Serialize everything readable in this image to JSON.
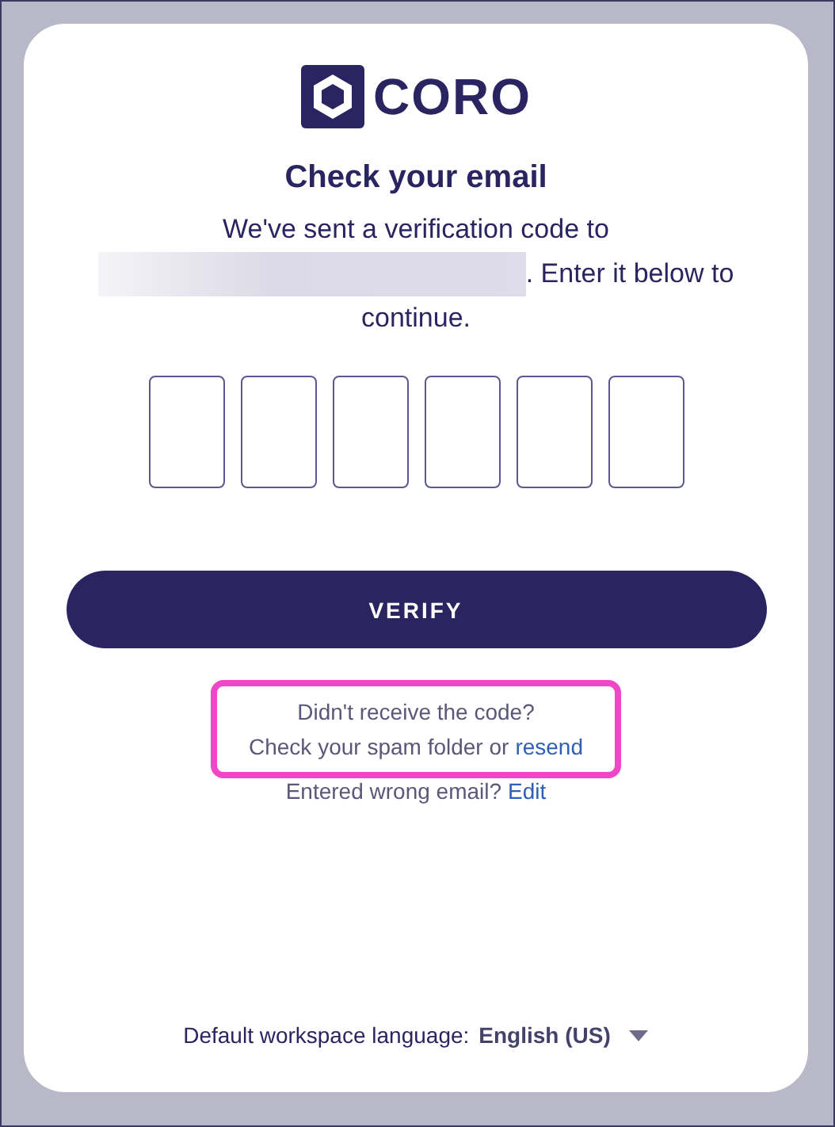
{
  "logo": {
    "wordmark": "CORO"
  },
  "title": "Check your email",
  "message": {
    "before": "We've sent a verification code to",
    "after": ". Enter it below to",
    "continuation": "continue.",
    "email_redacted": true
  },
  "code_inputs": [
    {
      "filled": false
    },
    {
      "filled": false
    },
    {
      "filled": false
    },
    {
      "filled": false
    },
    {
      "filled": false
    },
    {
      "filled": false
    }
  ],
  "verify_button": "VERIFY",
  "help": {
    "highlighted": true,
    "question": "Didn't receive the code?",
    "hint": "Check your spam folder or",
    "link": "resend"
  },
  "wrong_email": {
    "text": "Entered wrong email?",
    "link": "Edit"
  },
  "language": {
    "label": "Default workspace language:",
    "value": "English (US)"
  }
}
